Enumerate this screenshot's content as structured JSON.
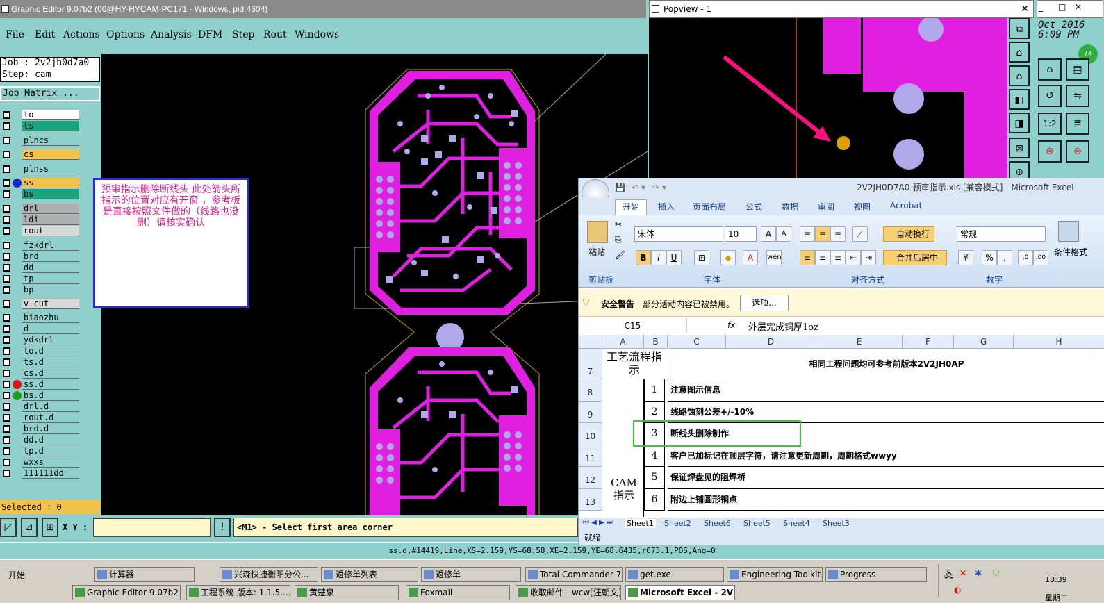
{
  "graphic_editor": {
    "title": "Graphic Editor 9.07b2 (00@HY-HYCAM-PC171 - Windows, pid:4604)",
    "menu": [
      "File",
      "Edit",
      "Actions",
      "Options",
      "Analysis",
      "DFM",
      "Step",
      "Rout",
      "Windows"
    ],
    "job": "Job : 2v2jh0d7a0",
    "step": "Step: cam",
    "job_matrix": "Job Matrix ...",
    "layers": [
      {
        "name": "to",
        "color": "#ffffff",
        "dot": ""
      },
      {
        "name": "ts",
        "color": "#1aa47e",
        "dot": ""
      },
      {
        "name": "plncs",
        "color": "#8fd0cc",
        "dot": ""
      },
      {
        "name": "cs",
        "color": "#f2c24a",
        "dot": ""
      },
      {
        "name": "plnss",
        "color": "#8fd0cc",
        "dot": ""
      },
      {
        "name": "ss",
        "color": "#f2c24a",
        "dot": "#1a2ad0"
      },
      {
        "name": "bs",
        "color": "#1aa47e",
        "dot": ""
      },
      {
        "name": "drl",
        "color": "#b0b0b0",
        "dot": ""
      },
      {
        "name": "ldi",
        "color": "#b0b0b0",
        "dot": ""
      },
      {
        "name": "rout",
        "color": "#d8d8d8",
        "dot": ""
      },
      {
        "name": "fzkdrl",
        "color": "#8fd0cc",
        "dot": ""
      },
      {
        "name": "brd",
        "color": "#8fd0cc",
        "dot": ""
      },
      {
        "name": "dd",
        "color": "#8fd0cc",
        "dot": ""
      },
      {
        "name": "tp",
        "color": "#8fd0cc",
        "dot": ""
      },
      {
        "name": "bp",
        "color": "#8fd0cc",
        "dot": ""
      },
      {
        "name": "v-cut",
        "color": "#d8d8d8",
        "dot": ""
      },
      {
        "name": "biaozhu",
        "color": "#8fd0cc",
        "dot": ""
      },
      {
        "name": "d",
        "color": "#8fd0cc",
        "dot": ""
      },
      {
        "name": "ydkdrl",
        "color": "#8fd0cc",
        "dot": ""
      },
      {
        "name": "to.d",
        "color": "#8fd0cc",
        "dot": ""
      },
      {
        "name": "ts.d",
        "color": "#8fd0cc",
        "dot": ""
      },
      {
        "name": "cs.d",
        "color": "#8fd0cc",
        "dot": ""
      },
      {
        "name": "ss.d",
        "color": "#8fd0cc",
        "dot": "#e01010"
      },
      {
        "name": "bs.d",
        "color": "#8fd0cc",
        "dot": "#20a020"
      },
      {
        "name": "drl.d",
        "color": "#8fd0cc",
        "dot": ""
      },
      {
        "name": "rout.d",
        "color": "#8fd0cc",
        "dot": ""
      },
      {
        "name": "brd.d",
        "color": "#8fd0cc",
        "dot": ""
      },
      {
        "name": "dd.d",
        "color": "#8fd0cc",
        "dot": ""
      },
      {
        "name": "tp.d",
        "color": "#8fd0cc",
        "dot": ""
      },
      {
        "name": "wxxs",
        "color": "#8fd0cc",
        "dot": ""
      },
      {
        "name": "111111dd",
        "color": "#8fd0cc",
        "dot": ""
      }
    ],
    "selected": "Selected : 0",
    "xy_label": "X Y :",
    "prompt": "<M1> - Select first area corner",
    "status": "ss.d,#14419,Line,XS=2.159,YS=68.58,XE=2.159,YE=68.6435,r673.1,POS,Ang=0"
  },
  "note": "预审指示删除断线头  此处箭头所指示的位置对应有开窗 ，参考板是直接按照文件做的（线路也没删）请核实确认",
  "popview": {
    "title": "Popview - 1",
    "clock": "Oct 2016",
    "time": "6:09 PM",
    "badge": "74"
  },
  "excel": {
    "title": "2V2JH0D7A0-预审指示.xls  [兼容模式] - Microsoft Excel",
    "tabs": [
      "开始",
      "插入",
      "页面布局",
      "公式",
      "数据",
      "审阅",
      "视图",
      "Acrobat"
    ],
    "paste": "粘贴",
    "font": "宋体",
    "size": "10",
    "wrap": "自动换行",
    "merge": "合并后居中",
    "number_format": "常规",
    "cond_format": "条件格式",
    "groups": [
      "剪贴板",
      "字体",
      "对齐方式",
      "数字"
    ],
    "warn_title": "安全警告",
    "warn_text": "部分活动内容已被禁用。",
    "options_btn": "选项...",
    "cell_ref": "C15",
    "fx": "fx",
    "formula": "外层完成铜厚1oz",
    "columns": [
      "A",
      "B",
      "C",
      "D",
      "E",
      "F",
      "G",
      "H"
    ],
    "header_a": "工艺流程指示",
    "header_c": "相同工程问题均可参考前版本2V2JH0AP",
    "cam_label": "CAM指示",
    "rows": [
      {
        "row": "8",
        "num": "1",
        "text": "注意图示信息"
      },
      {
        "row": "9",
        "num": "2",
        "text": "线路蚀刻公差+/-10%"
      },
      {
        "row": "10",
        "num": "3",
        "text": "断线头删除制作"
      },
      {
        "row": "11",
        "num": "4",
        "text": "客户已加标记在顶层字符，请注意更新周期，周期格式wwyy"
      },
      {
        "row": "12",
        "num": "5",
        "text": "保证焊盘见的阻焊桥"
      },
      {
        "row": "13",
        "num": "6",
        "text": "附边上铺圆形铜点"
      }
    ],
    "row7": "7",
    "sheets": [
      "Sheet1",
      "Sheet2",
      "Sheet6",
      "Sheet5",
      "Sheet4",
      "Sheet3"
    ],
    "status": "就绪"
  },
  "taskbar": {
    "start": "开始",
    "row1": [
      "计算器",
      "兴森快捷衡阳分公...",
      "返修单列表",
      "返修单",
      "Total Commander 7.0 ...",
      "get.exe",
      "Engineering Toolkit 9....",
      "Progress"
    ],
    "row2": [
      "Graphic Editor 9.07b2 (0...",
      "工程系统  版本: 1.1.5....",
      "黄楚泉",
      "Foxmail",
      "收取邮件 - wcw[汪朝文]",
      "Microsoft Excel - 2V2J..."
    ],
    "clock": "18:39",
    "day": "星期二"
  }
}
